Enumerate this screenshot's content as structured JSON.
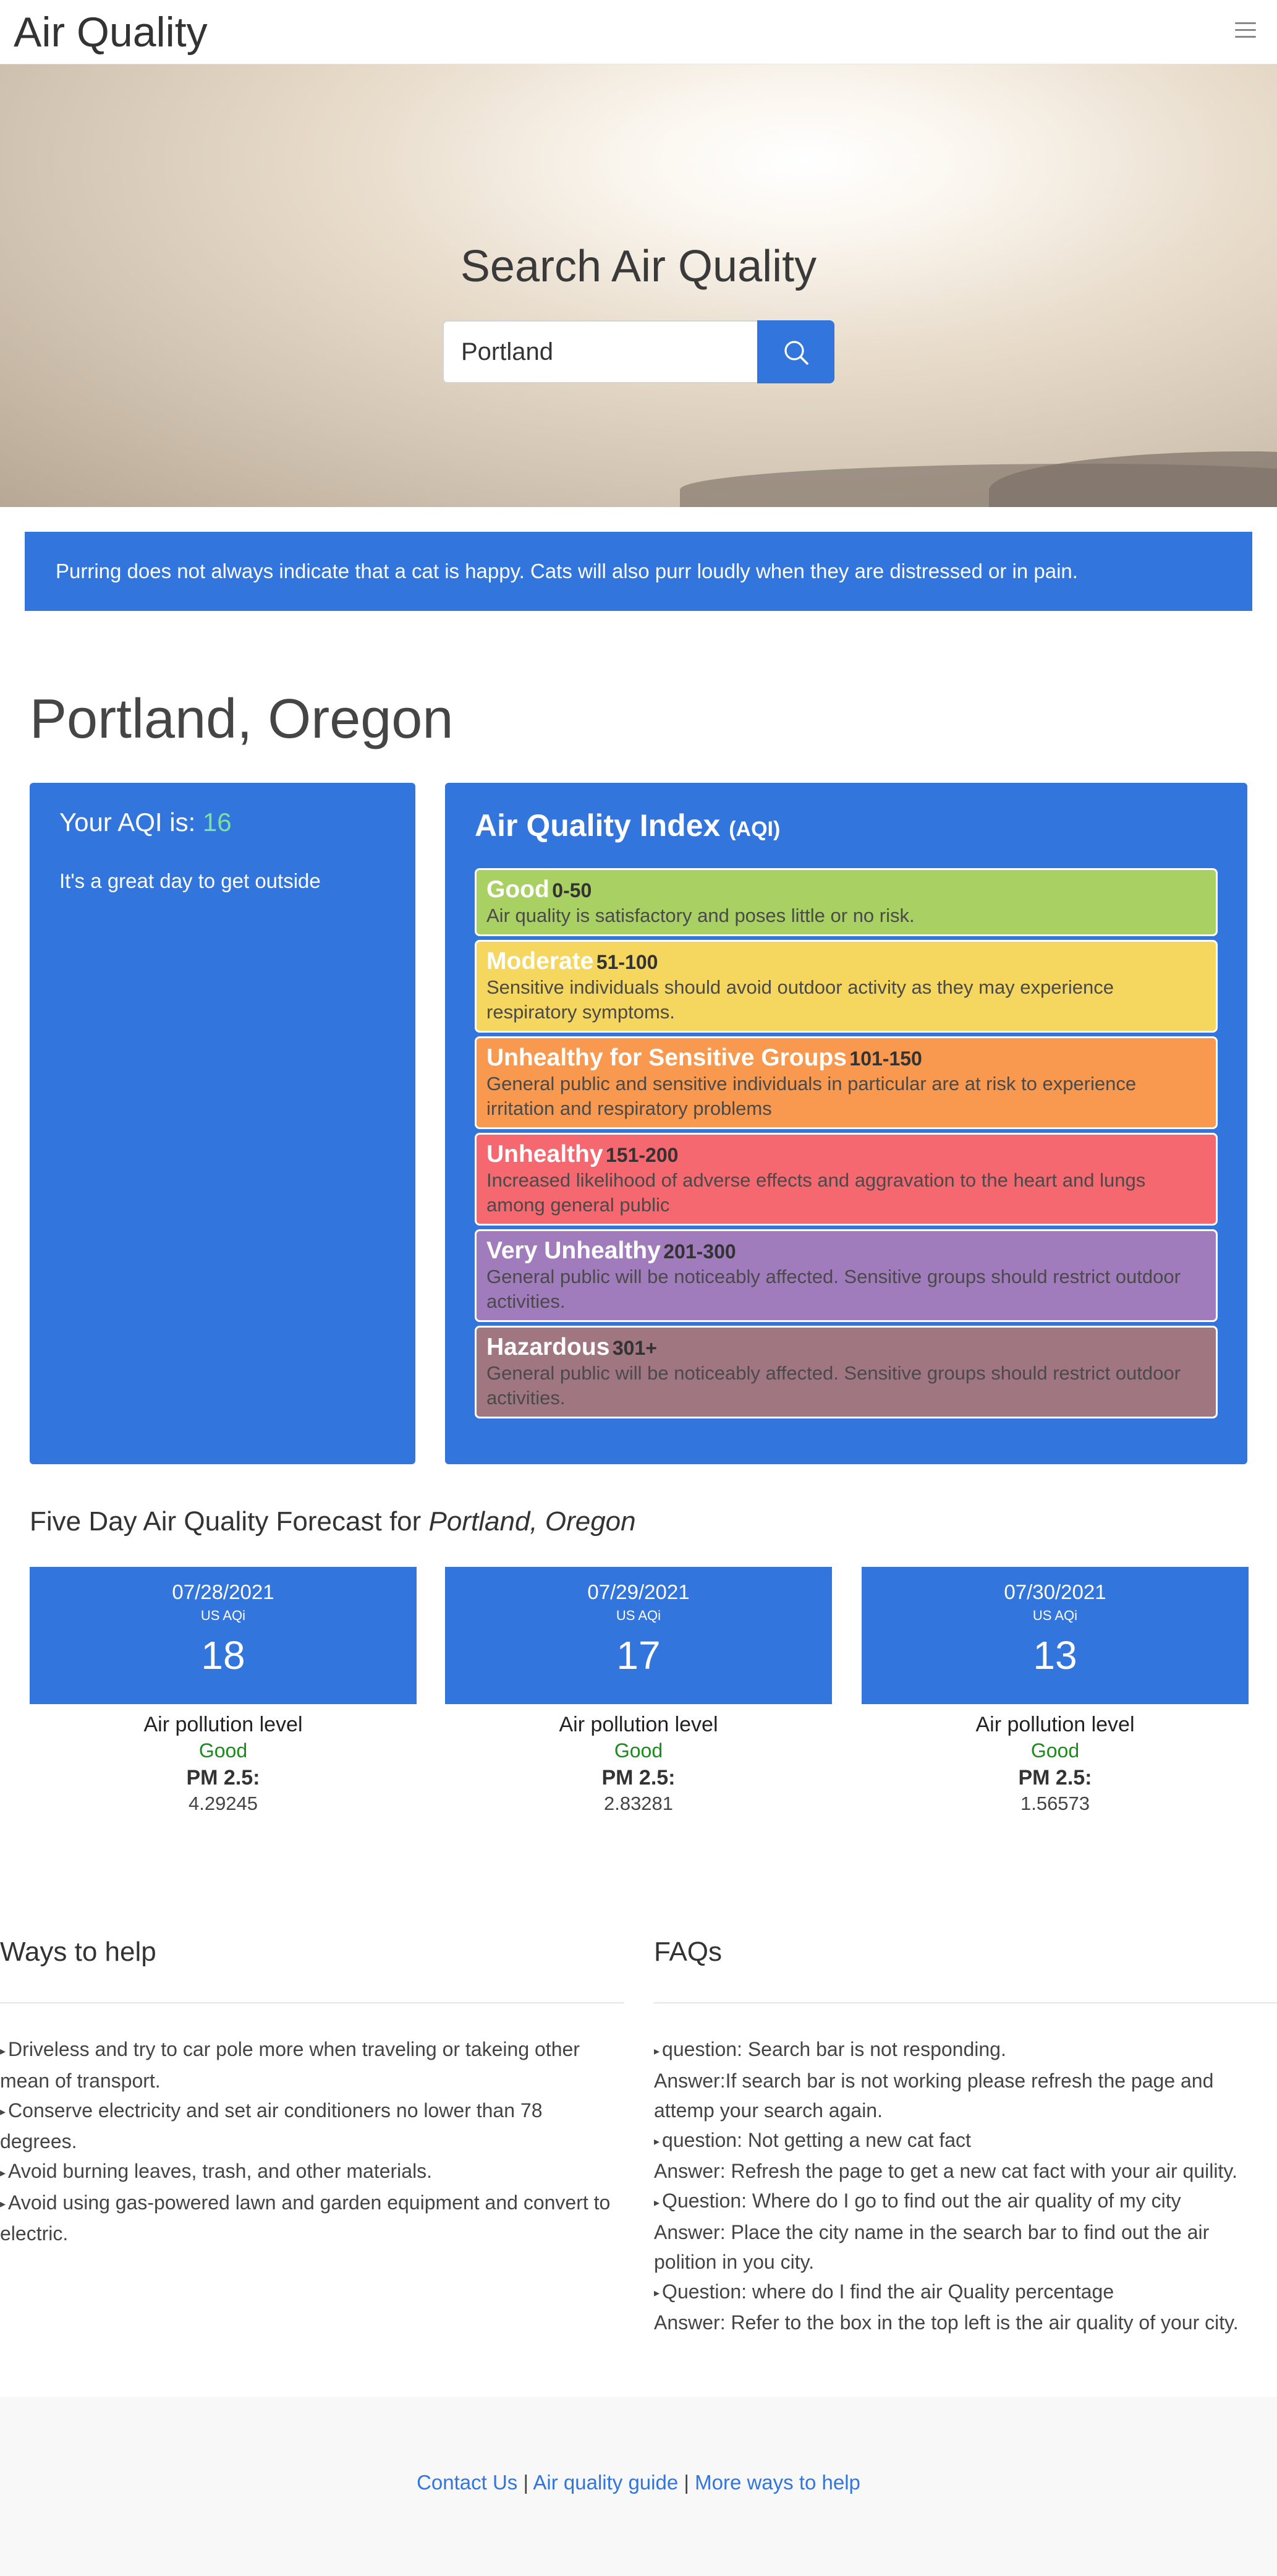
{
  "nav": {
    "brand": "Air Quality",
    "menu_icon": "hamburger-menu-icon"
  },
  "hero": {
    "title": "Search Air Quality",
    "search_value": "Portland",
    "search_icon": "search-icon"
  },
  "fact": "Purring does not always indicate that a cat is happy. Cats will also purr loudly when they are distressed or in pain.",
  "city": "Portland, Oregon",
  "aqi": {
    "prefix": "Your AQI is: ",
    "value": "16",
    "message": "It's a great day to get outside",
    "value_color": "#7ee0a0"
  },
  "index": {
    "title": "Air Quality Index ",
    "abbr": "(AQI)",
    "levels": [
      {
        "name": "Good",
        "range": "0-50",
        "desc": "Air quality is satisfactory and poses little or no risk.",
        "color": "#a9d063"
      },
      {
        "name": "Moderate",
        "range": "51-100",
        "desc": "Sensitive individuals should avoid outdoor activity as they may experience respiratory symptoms.",
        "color": "#f5d65e"
      },
      {
        "name": "Unhealthy for Sensitive Groups",
        "range": "101-150",
        "desc": "General public and sensitive individuals in particular are at risk to experience irritation and respiratory problems",
        "color": "#f8994f"
      },
      {
        "name": "Unhealthy",
        "range": "151-200",
        "desc": "Increased likelihood of adverse effects and aggravation to the heart and lungs among general public",
        "color": "#f5686f"
      },
      {
        "name": "Very Unhealthy",
        "range": "201-300",
        "desc": "General public will be noticeably affected. Sensitive groups should restrict outdoor activities.",
        "color": "#a17cbc"
      },
      {
        "name": "Hazardous",
        "range": "301+",
        "desc": "General public will be noticeably affected. Sensitive groups should restrict outdoor activities.",
        "color": "#a07681"
      }
    ]
  },
  "forecast": {
    "title": "Five Day Air Quality Forecast for ",
    "city": "Portland, Oregon",
    "days": [
      {
        "date": "07/28/2021",
        "unit": "US AQi",
        "aqi": "18",
        "label": "Air pollution level",
        "status": "Good",
        "pm_label": "PM 2.5:",
        "pm": "4.29245"
      },
      {
        "date": "07/29/2021",
        "unit": "US AQi",
        "aqi": "17",
        "label": "Air pollution level",
        "status": "Good",
        "pm_label": "PM 2.5:",
        "pm": "2.83281"
      },
      {
        "date": "07/30/2021",
        "unit": "US AQi",
        "aqi": "13",
        "label": "Air pollution level",
        "status": "Good",
        "pm_label": "PM 2.5:",
        "pm": "1.56573"
      }
    ]
  },
  "ways": {
    "title": "Ways to help",
    "items": [
      "Driveless and try to car pole more when traveling or takeing other mean of transport.",
      "Conserve electricity and set air conditioners no lower than 78 degrees.",
      "Avoid burning leaves, trash, and other materials.",
      "Avoid using gas-powered lawn and garden equipment and convert to electric."
    ]
  },
  "faqs": {
    "title": "FAQs",
    "items": [
      {
        "q": "question: Search bar is not responding.",
        "a": "Answer:If search bar is not working please refresh the page and attemp your search again."
      },
      {
        "q": "question: Not getting a new cat fact",
        "a": "Answer: Refresh the page to get a new cat fact with your air quility."
      },
      {
        "q": "Question: Where do I go to find out the air quality of my city",
        "a": "Answer: Place the city name in the search bar to find out the air polition in you city."
      },
      {
        "q": "Question: where do I find the air Quality percentage",
        "a": "Answer: Refer to the box in the top left is the air quality of your city."
      }
    ]
  },
  "footer": {
    "contact": "Contact Us",
    "guide": "Air quality guide",
    "more": "More ways to help",
    "sep": " | "
  }
}
